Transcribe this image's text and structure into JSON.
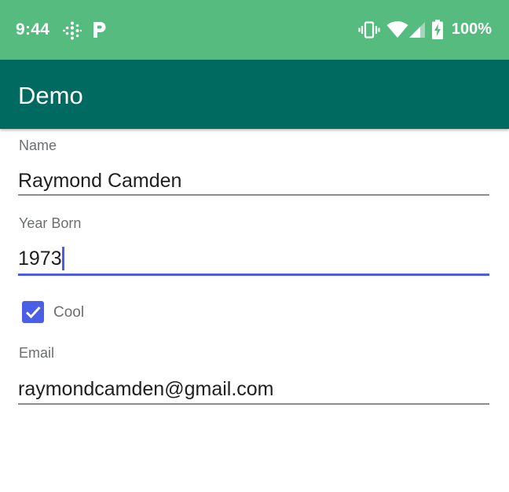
{
  "status_bar": {
    "time": "9:44",
    "battery_percent": "100%",
    "icons": [
      "fitbit-icon",
      "parking-p-icon",
      "vibrate-icon",
      "wifi-icon",
      "cell-signal-icon",
      "battery-charging-icon"
    ],
    "background_color": "#55bb7e"
  },
  "app_bar": {
    "title": "Demo",
    "background_color": "#006a61"
  },
  "form": {
    "name": {
      "label": "Name",
      "value": "Raymond Camden"
    },
    "year_born": {
      "label": "Year Born",
      "value": "1973",
      "focused": true
    },
    "cool": {
      "label": "Cool",
      "checked": true
    },
    "email": {
      "label": "Email",
      "value": "raymondcamden@gmail.com"
    }
  },
  "accent_color": "#4a5ee6"
}
